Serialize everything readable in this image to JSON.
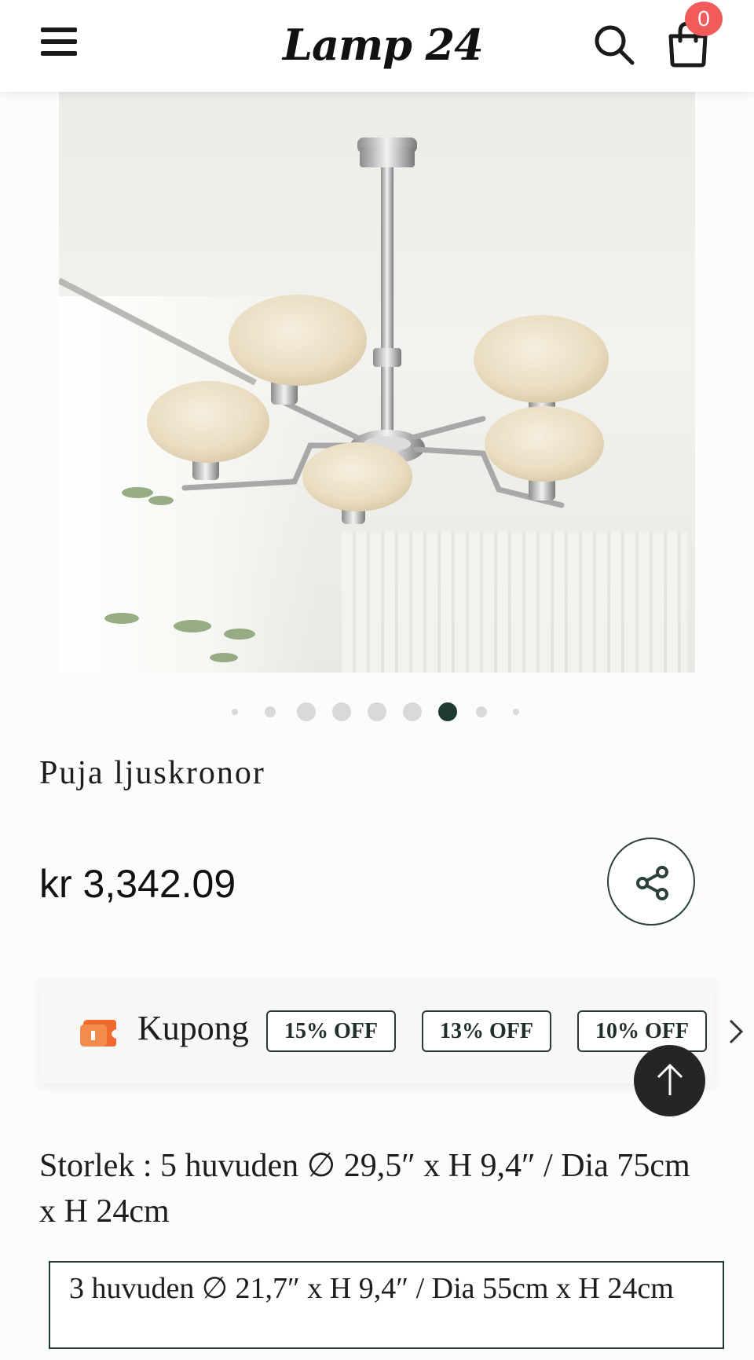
{
  "header": {
    "logo_text": "Lamp 24",
    "cart_count": "0"
  },
  "product": {
    "title": "Puja ljuskronor",
    "price": "kr 3,342.09",
    "carousel": {
      "total_dots": 9,
      "active_index": 6
    }
  },
  "coupons": {
    "label": "Kupong",
    "tags": [
      "15% OFF",
      "13% OFF",
      "10% OFF"
    ]
  },
  "size": {
    "label": "Storlek : 5 huvuden ∅ 29,5″ x H 9,4″ / Dia 75cm x H 24cm",
    "option": "3 huvuden ∅ 21,7″ x H 9,4″ / Dia 55cm x H 24cm"
  },
  "colors": {
    "accent_dark_green": "#1f3a30",
    "badge_red": "#f15b5b",
    "coupon_icon_orange": "#f26a2e"
  },
  "icons": [
    "menu-icon",
    "search-icon",
    "shopping-bag-icon",
    "share-icon",
    "coupon-ticket-icon",
    "chevron-right-icon",
    "arrow-up-icon"
  ]
}
